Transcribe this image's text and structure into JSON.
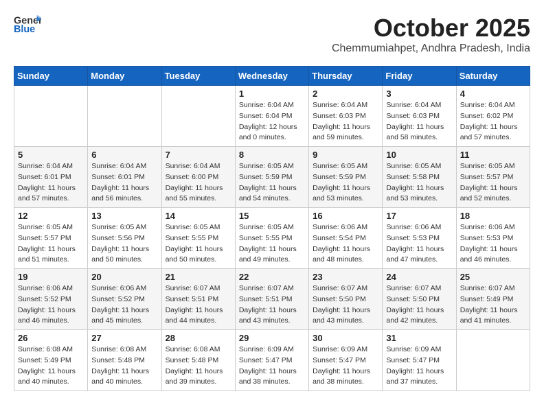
{
  "logo": {
    "general": "General",
    "blue": "Blue"
  },
  "title": "October 2025",
  "location": "Chemmumiahpet, Andhra Pradesh, India",
  "weekdays": [
    "Sunday",
    "Monday",
    "Tuesday",
    "Wednesday",
    "Thursday",
    "Friday",
    "Saturday"
  ],
  "weeks": [
    [
      {
        "day": "",
        "sunrise": "",
        "sunset": "",
        "daylight": ""
      },
      {
        "day": "",
        "sunrise": "",
        "sunset": "",
        "daylight": ""
      },
      {
        "day": "",
        "sunrise": "",
        "sunset": "",
        "daylight": ""
      },
      {
        "day": "1",
        "sunrise": "Sunrise: 6:04 AM",
        "sunset": "Sunset: 6:04 PM",
        "daylight": "Daylight: 12 hours and 0 minutes."
      },
      {
        "day": "2",
        "sunrise": "Sunrise: 6:04 AM",
        "sunset": "Sunset: 6:03 PM",
        "daylight": "Daylight: 11 hours and 59 minutes."
      },
      {
        "day": "3",
        "sunrise": "Sunrise: 6:04 AM",
        "sunset": "Sunset: 6:03 PM",
        "daylight": "Daylight: 11 hours and 58 minutes."
      },
      {
        "day": "4",
        "sunrise": "Sunrise: 6:04 AM",
        "sunset": "Sunset: 6:02 PM",
        "daylight": "Daylight: 11 hours and 57 minutes."
      }
    ],
    [
      {
        "day": "5",
        "sunrise": "Sunrise: 6:04 AM",
        "sunset": "Sunset: 6:01 PM",
        "daylight": "Daylight: 11 hours and 57 minutes."
      },
      {
        "day": "6",
        "sunrise": "Sunrise: 6:04 AM",
        "sunset": "Sunset: 6:01 PM",
        "daylight": "Daylight: 11 hours and 56 minutes."
      },
      {
        "day": "7",
        "sunrise": "Sunrise: 6:04 AM",
        "sunset": "Sunset: 6:00 PM",
        "daylight": "Daylight: 11 hours and 55 minutes."
      },
      {
        "day": "8",
        "sunrise": "Sunrise: 6:05 AM",
        "sunset": "Sunset: 5:59 PM",
        "daylight": "Daylight: 11 hours and 54 minutes."
      },
      {
        "day": "9",
        "sunrise": "Sunrise: 6:05 AM",
        "sunset": "Sunset: 5:59 PM",
        "daylight": "Daylight: 11 hours and 53 minutes."
      },
      {
        "day": "10",
        "sunrise": "Sunrise: 6:05 AM",
        "sunset": "Sunset: 5:58 PM",
        "daylight": "Daylight: 11 hours and 53 minutes."
      },
      {
        "day": "11",
        "sunrise": "Sunrise: 6:05 AM",
        "sunset": "Sunset: 5:57 PM",
        "daylight": "Daylight: 11 hours and 52 minutes."
      }
    ],
    [
      {
        "day": "12",
        "sunrise": "Sunrise: 6:05 AM",
        "sunset": "Sunset: 5:57 PM",
        "daylight": "Daylight: 11 hours and 51 minutes."
      },
      {
        "day": "13",
        "sunrise": "Sunrise: 6:05 AM",
        "sunset": "Sunset: 5:56 PM",
        "daylight": "Daylight: 11 hours and 50 minutes."
      },
      {
        "day": "14",
        "sunrise": "Sunrise: 6:05 AM",
        "sunset": "Sunset: 5:55 PM",
        "daylight": "Daylight: 11 hours and 50 minutes."
      },
      {
        "day": "15",
        "sunrise": "Sunrise: 6:05 AM",
        "sunset": "Sunset: 5:55 PM",
        "daylight": "Daylight: 11 hours and 49 minutes."
      },
      {
        "day": "16",
        "sunrise": "Sunrise: 6:06 AM",
        "sunset": "Sunset: 5:54 PM",
        "daylight": "Daylight: 11 hours and 48 minutes."
      },
      {
        "day": "17",
        "sunrise": "Sunrise: 6:06 AM",
        "sunset": "Sunset: 5:53 PM",
        "daylight": "Daylight: 11 hours and 47 minutes."
      },
      {
        "day": "18",
        "sunrise": "Sunrise: 6:06 AM",
        "sunset": "Sunset: 5:53 PM",
        "daylight": "Daylight: 11 hours and 46 minutes."
      }
    ],
    [
      {
        "day": "19",
        "sunrise": "Sunrise: 6:06 AM",
        "sunset": "Sunset: 5:52 PM",
        "daylight": "Daylight: 11 hours and 46 minutes."
      },
      {
        "day": "20",
        "sunrise": "Sunrise: 6:06 AM",
        "sunset": "Sunset: 5:52 PM",
        "daylight": "Daylight: 11 hours and 45 minutes."
      },
      {
        "day": "21",
        "sunrise": "Sunrise: 6:07 AM",
        "sunset": "Sunset: 5:51 PM",
        "daylight": "Daylight: 11 hours and 44 minutes."
      },
      {
        "day": "22",
        "sunrise": "Sunrise: 6:07 AM",
        "sunset": "Sunset: 5:51 PM",
        "daylight": "Daylight: 11 hours and 43 minutes."
      },
      {
        "day": "23",
        "sunrise": "Sunrise: 6:07 AM",
        "sunset": "Sunset: 5:50 PM",
        "daylight": "Daylight: 11 hours and 43 minutes."
      },
      {
        "day": "24",
        "sunrise": "Sunrise: 6:07 AM",
        "sunset": "Sunset: 5:50 PM",
        "daylight": "Daylight: 11 hours and 42 minutes."
      },
      {
        "day": "25",
        "sunrise": "Sunrise: 6:07 AM",
        "sunset": "Sunset: 5:49 PM",
        "daylight": "Daylight: 11 hours and 41 minutes."
      }
    ],
    [
      {
        "day": "26",
        "sunrise": "Sunrise: 6:08 AM",
        "sunset": "Sunset: 5:49 PM",
        "daylight": "Daylight: 11 hours and 40 minutes."
      },
      {
        "day": "27",
        "sunrise": "Sunrise: 6:08 AM",
        "sunset": "Sunset: 5:48 PM",
        "daylight": "Daylight: 11 hours and 40 minutes."
      },
      {
        "day": "28",
        "sunrise": "Sunrise: 6:08 AM",
        "sunset": "Sunset: 5:48 PM",
        "daylight": "Daylight: 11 hours and 39 minutes."
      },
      {
        "day": "29",
        "sunrise": "Sunrise: 6:09 AM",
        "sunset": "Sunset: 5:47 PM",
        "daylight": "Daylight: 11 hours and 38 minutes."
      },
      {
        "day": "30",
        "sunrise": "Sunrise: 6:09 AM",
        "sunset": "Sunset: 5:47 PM",
        "daylight": "Daylight: 11 hours and 38 minutes."
      },
      {
        "day": "31",
        "sunrise": "Sunrise: 6:09 AM",
        "sunset": "Sunset: 5:47 PM",
        "daylight": "Daylight: 11 hours and 37 minutes."
      },
      {
        "day": "",
        "sunrise": "",
        "sunset": "",
        "daylight": ""
      }
    ]
  ]
}
